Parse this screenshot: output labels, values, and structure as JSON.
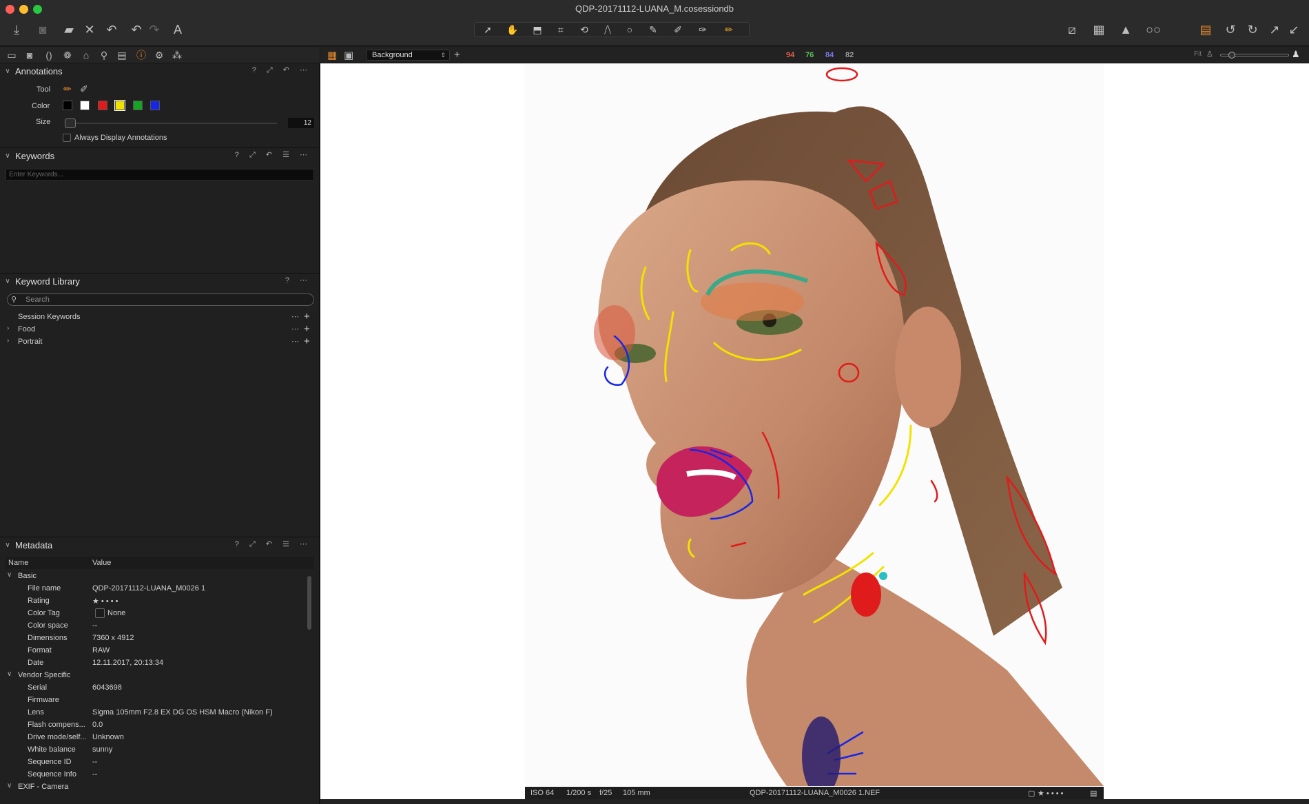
{
  "window": {
    "title": "QDP-20171112-LUANA_M.cosessiondb"
  },
  "toolbar": {
    "left_icons": [
      "import-icon",
      "camera-icon",
      "move-icon",
      "delete-icon",
      "undo-all-icon",
      "undo-icon",
      "redo-icon",
      "text-icon"
    ],
    "center_tools": [
      "select-cursor-icon",
      "pan-icon",
      "loupe-icon",
      "crop-icon",
      "rotate-icon",
      "keystone-icon",
      "spot-removal-icon",
      "brush-icon",
      "color-picker-icon",
      "eraser-icon",
      "annotation-pen-icon"
    ],
    "right_icons": [
      "edit-icon",
      "grid-icon",
      "warning-icon",
      "glasses-icon",
      "stack-icon",
      "rotate-left-icon",
      "rotate-right-icon",
      "expand-icon",
      "collapse-icon"
    ]
  },
  "tool_tabs": [
    "folder-icon",
    "capture-icon",
    "lens-icon",
    "color-icon",
    "exposure-icon",
    "details-icon",
    "search-icon",
    "output-icon",
    "metadata-info-icon",
    "settings-icon",
    "batch-icon"
  ],
  "annotations": {
    "title": "Annotations",
    "tool_label": "Tool",
    "color_label": "Color",
    "size_label": "Size",
    "size_value": "12",
    "always_display": "Always Display Annotations",
    "colors": [
      "#000000",
      "#ffffff",
      "#e01b1b",
      "#f2e200",
      "#16a326",
      "#1626e8"
    ],
    "selected_color": "#f2e200"
  },
  "keywords": {
    "title": "Keywords",
    "placeholder": "Enter Keywords..."
  },
  "keyword_library": {
    "title": "Keyword Library",
    "search_placeholder": "Search",
    "items": [
      {
        "label": "Session Keywords",
        "expandable": false
      },
      {
        "label": "Food",
        "expandable": true
      },
      {
        "label": "Portrait",
        "expandable": true
      }
    ]
  },
  "metadata": {
    "title": "Metadata",
    "col_name": "Name",
    "col_value": "Value",
    "groups": [
      {
        "name": "Basic",
        "rows": [
          {
            "k": "File name",
            "v": "QDP-20171112-LUANA_M0026 1"
          },
          {
            "k": "Rating",
            "v": "★ • • • •"
          },
          {
            "k": "Color Tag",
            "v": "None"
          },
          {
            "k": "Color space",
            "v": "--"
          },
          {
            "k": "Dimensions",
            "v": "7360 x 4912"
          },
          {
            "k": "Format",
            "v": "RAW"
          },
          {
            "k": "Date",
            "v": "12.11.2017, 20:13:34"
          }
        ]
      },
      {
        "name": "Vendor Specific",
        "rows": [
          {
            "k": "Serial",
            "v": "6043698"
          },
          {
            "k": "Firmware",
            "v": ""
          },
          {
            "k": "Lens",
            "v": "Sigma 105mm F2.8 EX DG OS HSM Macro (Nikon F)"
          },
          {
            "k": "Flash compens...",
            "v": "0.0"
          },
          {
            "k": "Drive mode/self...",
            "v": "Unknown"
          },
          {
            "k": "White balance",
            "v": "sunny"
          },
          {
            "k": "Sequence ID",
            "v": "--"
          },
          {
            "k": "Sequence Info",
            "v": "--"
          }
        ]
      },
      {
        "name": "EXIF - Camera",
        "rows": []
      }
    ]
  },
  "viewer": {
    "layer": "Background",
    "readouts": [
      {
        "value": "94",
        "color": "#e0604a"
      },
      {
        "value": "76",
        "color": "#5fc35a"
      },
      {
        "value": "84",
        "color": "#7a7ae6"
      },
      {
        "value": "82",
        "color": "#9a9a9a"
      }
    ],
    "fit_label": "Fit",
    "info": {
      "iso": "ISO 64",
      "shutter": "1/200 s",
      "aperture": "f/25",
      "focal": "105 mm",
      "filename": "QDP-20171112-LUANA_M0026 1.NEF",
      "rating": "★ • • • •"
    }
  }
}
